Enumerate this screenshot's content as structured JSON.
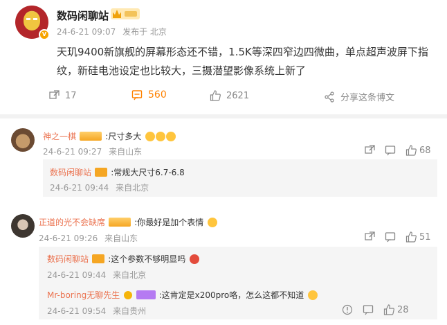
{
  "post": {
    "author": "数码闲聊站",
    "time": "24-6-21 09:07",
    "source": "发布于 北京",
    "content": "天玑9400新旗舰的屏幕形态还不错，1.5K等深四窄边四微曲，单点超声波屏下指纹，新硅电池设定也比较大，三摄潜望影像系统上新了",
    "reposts": "17",
    "comments": "560",
    "likes": "2621",
    "share": "分享这条博文"
  },
  "comments": [
    {
      "name": "神之一棋",
      "text": ":尺寸多大",
      "time": "24-6-21 09:27",
      "location": "来自山东",
      "likes": "68",
      "reply": {
        "name": "数码闲聊站",
        "text": ":常规大尺寸6.7-6.8",
        "time": "24-6-21 09:44",
        "location": "来自北京"
      }
    },
    {
      "name": "正道的光不会缺席",
      "text": ":你最好是加个表情",
      "time": "24-6-21 09:26",
      "location": "来自山东",
      "likes": "51",
      "replies": [
        {
          "name": "数码闲聊站",
          "text": ":这个参数不够明显吗",
          "time": "24-6-21 09:44",
          "location": "来自北京"
        },
        {
          "name": "Mr-boring无聊先生",
          "text": ":这肯定是x200pro咯，怎么这都不知道",
          "time": "24-6-21 09:54",
          "location": "来自贵州",
          "likes": "28"
        }
      ]
    }
  ]
}
